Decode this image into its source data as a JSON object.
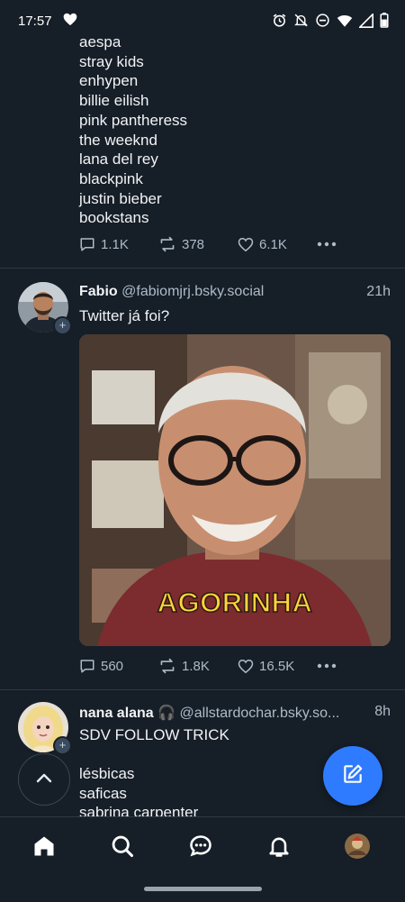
{
  "status": {
    "time": "17:57"
  },
  "post1": {
    "lines": [
      "aespa",
      "stray kids",
      "enhypen",
      "billie eilish",
      "pink pantheress",
      "the weeknd",
      "lana del rey",
      "blackpink",
      "justin bieber",
      "bookstans"
    ],
    "replies": "1.1K",
    "reposts": "378",
    "likes": "6.1K"
  },
  "post2": {
    "name": "Fabio",
    "handle": "@fabiomjrj.bsky.social",
    "time": "21h",
    "text": "Twitter já foi?",
    "media_caption": "AGORINHA",
    "replies": "560",
    "reposts": "1.8K",
    "likes": "16.5K"
  },
  "post3": {
    "name": "nana alana 🎧",
    "handle": "@allstardochar.bsky.so...",
    "time": "8h",
    "text": "SDV FOLLOW TRICK",
    "lines": [
      "lésbicas",
      "saficas",
      "sabrina carpenter"
    ]
  },
  "colors": {
    "background": "#161e27",
    "accent": "#2f7bff",
    "muted": "#aebbc9"
  }
}
